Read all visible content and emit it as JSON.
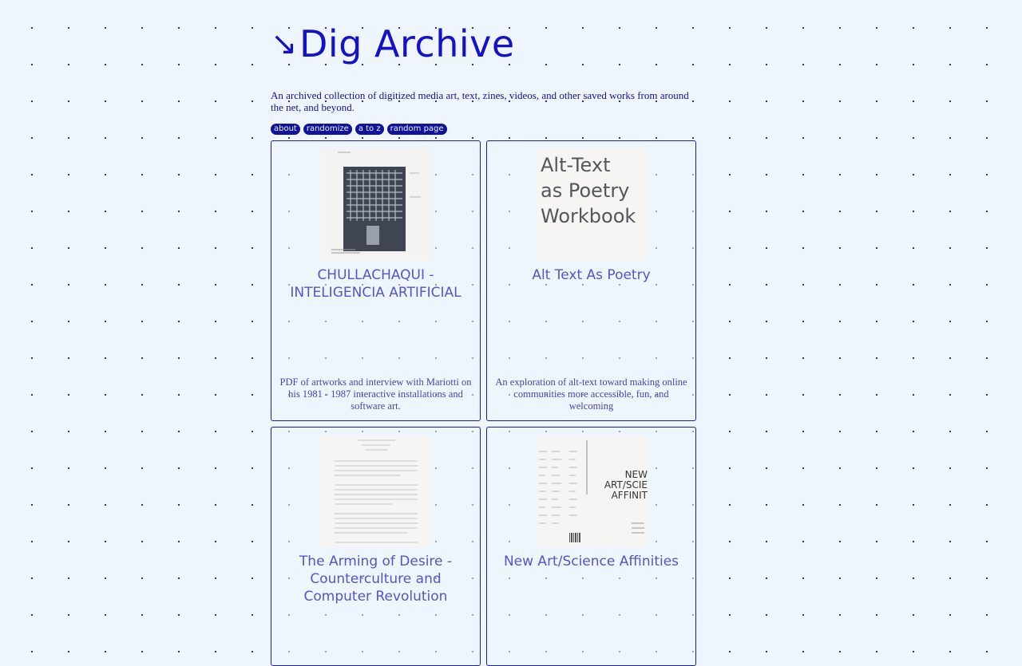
{
  "site": {
    "title": "Dig Archive",
    "title_arrow": "↘",
    "description": "An archived collection of digitized media art, text, zines, videos, and other saved works from around the net, and beyond."
  },
  "nav": {
    "about": "about",
    "randomize": "randomize",
    "a_to_z": "a to z",
    "random_page": "random page"
  },
  "cards": [
    {
      "title": "CHULLACHAQUI - INTELIGENCIA ARTIFICIAL",
      "description": "PDF of artworks and interview with Mariotti on his 1981 - 1987 interactive installations and software art."
    },
    {
      "title": "Alt Text As Poetry",
      "description": "An exploration of alt-text toward making online communities more accessible, fun, and welcoming",
      "thumb_lines": [
        "Alt-Text",
        "as Poetry",
        "Workbook"
      ]
    },
    {
      "title": "The Arming of Desire - Counterculture and Computer Revolution",
      "description": ""
    },
    {
      "title": "New Art/Science Affinities",
      "description": "",
      "thumb_lines": [
        "NEW",
        "ART/SCIE",
        "AFFINIT"
      ]
    }
  ],
  "colors": {
    "accent": "#1411c8",
    "ink": "#12129a",
    "background": "#eef5fd"
  }
}
